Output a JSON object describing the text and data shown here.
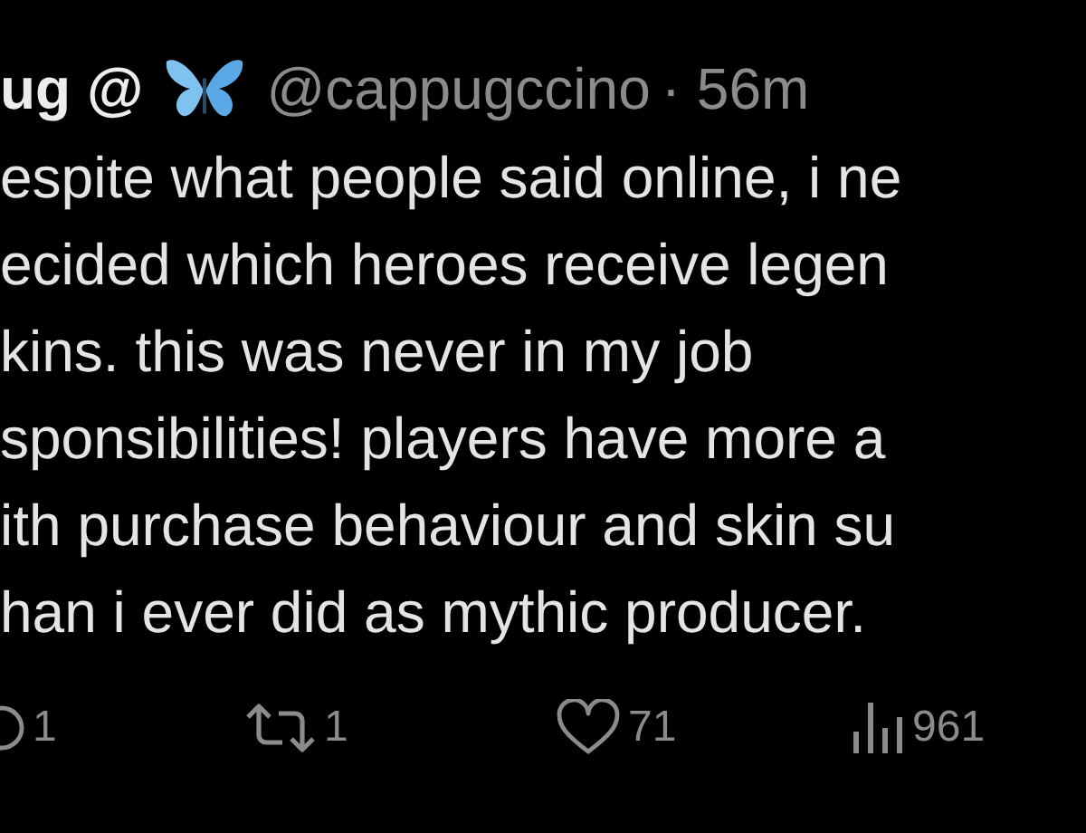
{
  "tweet": {
    "author_name": "ug @",
    "handle": "@cappugccino",
    "time": "· 56m",
    "lines": [
      "espite what people said online, i ne",
      "ecided which heroes receive legen",
      "kins. this was never in my job",
      "sponsibilities! players have more a",
      "ith purchase behaviour and skin su",
      "han i ever did as mythic producer."
    ],
    "actions": [
      {
        "kind": "reply",
        "count": "1"
      },
      {
        "kind": "repost",
        "count": "1"
      },
      {
        "kind": "like",
        "count": "71"
      },
      {
        "kind": "views",
        "count": "961"
      }
    ]
  }
}
